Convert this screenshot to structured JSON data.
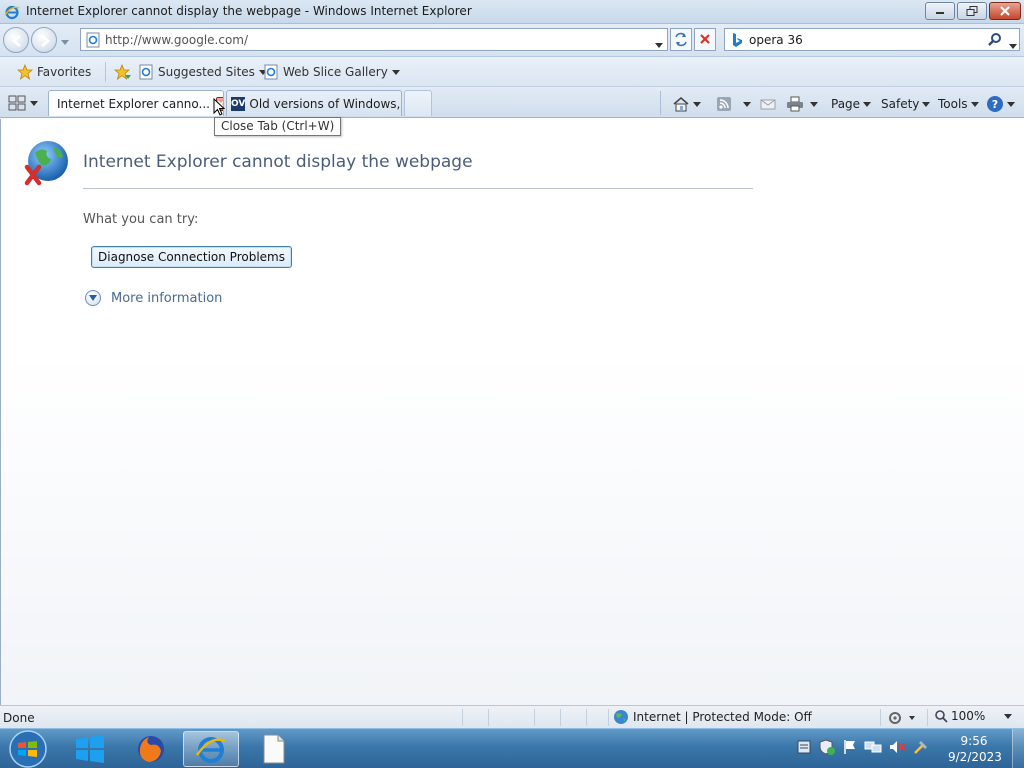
{
  "window": {
    "title": "Internet Explorer cannot display the webpage - Windows Internet Explorer"
  },
  "nav": {
    "address": "http://www.google.com/",
    "search_value": "opera 36"
  },
  "favorites_bar": {
    "favorites_label": "Favorites",
    "suggested_sites_label": "Suggested Sites",
    "web_slice_gallery_label": "Web Slice Gallery"
  },
  "tabs": [
    {
      "label": "Internet Explorer canno...",
      "active": true
    },
    {
      "label": "Old versions of Windows, ...",
      "favicon_text": "OV",
      "active": false
    }
  ],
  "command_bar": {
    "page_label": "Page",
    "safety_label": "Safety",
    "tools_label": "Tools"
  },
  "tooltip": {
    "text": "Close Tab (Ctrl+W)"
  },
  "error_page": {
    "title": "Internet Explorer cannot display the webpage",
    "what_you_can_try": "What you can try:",
    "diagnose_button": "Diagnose Connection Problems",
    "more_information": "More information"
  },
  "status_bar": {
    "status": "Done",
    "zone": "Internet | Protected Mode: Off",
    "zoom": "100%"
  },
  "taskbar": {
    "time": "9:56",
    "date": "9/2/2023"
  },
  "colors": {
    "error_title": "#4b5d79",
    "link_blue": "#4a6a92",
    "taskbar": "#3b77aa"
  }
}
